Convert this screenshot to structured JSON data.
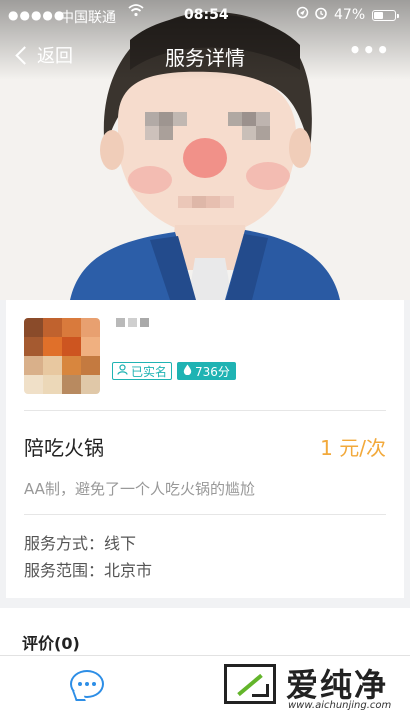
{
  "status_bar": {
    "signal": "●●●●●",
    "carrier": "中国联通",
    "wifi_icon": "wifi-icon",
    "time": "08:54",
    "battery": "47%",
    "battery_level": 0.47
  },
  "nav": {
    "back_label": "返回",
    "title": "服务详情",
    "more_label": "•••"
  },
  "profile": {
    "verified_label": "已实名",
    "score": "736分"
  },
  "service": {
    "title": "陪吃火锅",
    "price": "1 元/次",
    "description": "AA制，避免了一个人吃火锅的尴尬",
    "mode_label": "服务方式：",
    "mode_value": "线下",
    "area_label": "服务范围：",
    "area_value": "北京市"
  },
  "review": {
    "title": "评价(0)"
  },
  "watermark": {
    "text": "爱纯净",
    "url": "www.aichunjing.com"
  },
  "colors": {
    "accent_teal": "#1fb3b3",
    "price_orange": "#f2a93b",
    "chat_blue": "#2d8ee6",
    "watermark_green": "#63b52b"
  }
}
